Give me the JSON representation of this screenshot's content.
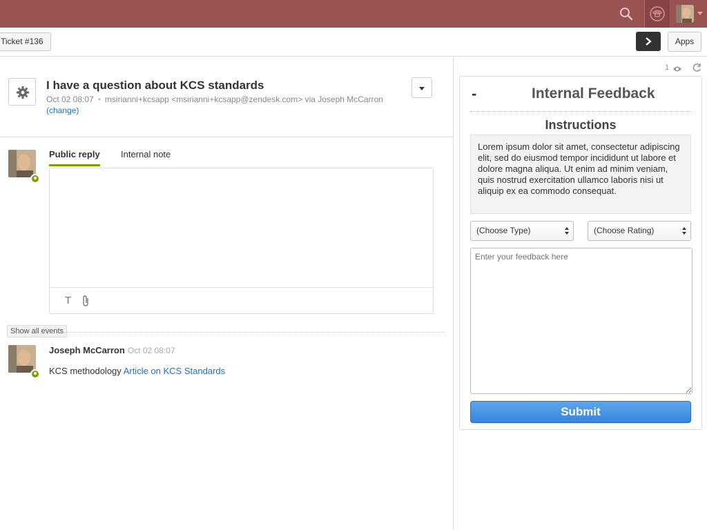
{
  "topbar": {
    "search_icon": "search-icon",
    "phone_icon": "phone-icon",
    "brand_color": "#9a5253"
  },
  "subbar": {
    "ticket_tab_label": "Ticket #136",
    "next_icon": "chevron-right-icon",
    "apps_label": "Apps"
  },
  "ticket": {
    "title": "I have a question about KCS standards",
    "date": "Oct 02 08:07",
    "requester": "msirianni+kcsapp <msirianni+kcsapp@zendesk.com> via Joseph McCarron",
    "change_link": "(change)"
  },
  "composer": {
    "tabs": [
      {
        "label": "Public reply",
        "active": true
      },
      {
        "label": "Internal note",
        "active": false
      }
    ],
    "format_icon": "T",
    "attach_icon": "paperclip-icon",
    "accent_color": "#78a300"
  },
  "events": {
    "show_all_label": "Show all events",
    "comment": {
      "author": "Joseph McCarron",
      "date": "Oct 02 08:07",
      "text": "KCS methodology",
      "link": "Article on KCS Standards"
    }
  },
  "app_panel": {
    "watchers": "1",
    "collapse_label": "-",
    "title": "Internal Feedback",
    "instructions_title": "Instructions",
    "instructions_text": "Lorem ipsum dolor sit amet, consectetur adipiscing elit, sed do eiusmod tempor incididunt ut labore et dolore magna aliqua. Ut enim ad minim veniam, quis nostrud exercitation ullamco laboris nisi ut aliquip ex ea commodo consequat.",
    "type_select": "(Choose Type)",
    "rating_select": "(Choose Rating)",
    "feedback_placeholder": "Enter your feedback here",
    "submit_label": "Submit",
    "submit_color": "#3784dc"
  }
}
